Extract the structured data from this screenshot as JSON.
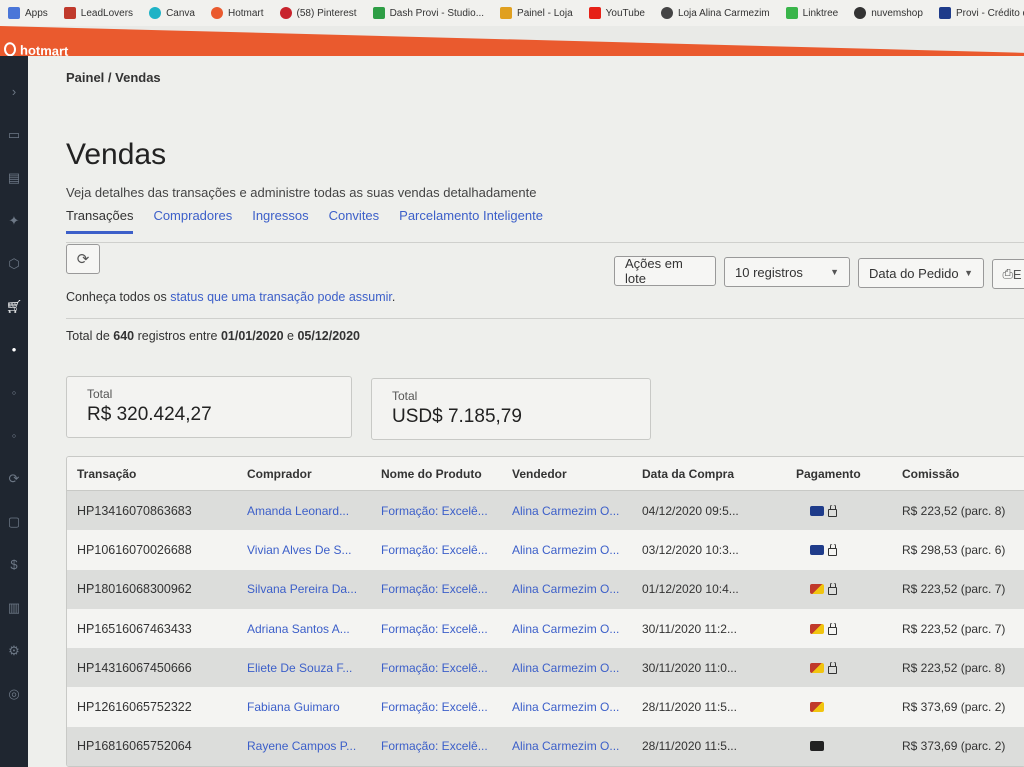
{
  "bookmarks": [
    {
      "label": "Apps",
      "color": "#4a76d8"
    },
    {
      "label": "LeadLovers",
      "color": "#c0392b"
    },
    {
      "label": "Canva",
      "color": "#1fb3c6"
    },
    {
      "label": "Hotmart",
      "color": "#ea5a2e"
    },
    {
      "label": "(58) Pinterest",
      "color": "#c8232c"
    },
    {
      "label": "Dash Provi - Studio...",
      "color": "#2e9e45"
    },
    {
      "label": "Painel - Loja",
      "color": "#e0a020"
    },
    {
      "label": "YouTube",
      "color": "#e62117"
    },
    {
      "label": "Loja Alina Carmezim",
      "color": "#444444"
    },
    {
      "label": "Linktree",
      "color": "#39b54a"
    },
    {
      "label": "nuvemshop",
      "color": "#333333"
    },
    {
      "label": "Provi - Crédito que...",
      "color": "#1e3b8a"
    }
  ],
  "header": {
    "logo_text": "hotmart",
    "color": "#ea5a2e"
  },
  "breadcrumb": "Painel  /  Vendas",
  "page": {
    "title": "Vendas",
    "subtitle": "Veja detalhes das transações e administre todas as suas vendas detalhadamente"
  },
  "tabs": [
    "Transações",
    "Compradores",
    "Ingressos",
    "Convites",
    "Parcelamento Inteligente"
  ],
  "toolbar": {
    "lote_label": "Ações em lote",
    "registros_label": "10 registros",
    "data_label": "Data do Pedido",
    "export_label": "E"
  },
  "status_text": {
    "prefix": "Conheça todos os ",
    "link": "status que uma transação pode assumir",
    "suffix": "."
  },
  "summary": {
    "prefix": "Total de ",
    "count": "640",
    "mid": " registros entre ",
    "start": "01/01/2020",
    "and": " e ",
    "end": "05/12/2020"
  },
  "cards": [
    {
      "label": "Total",
      "value": "R$ 320.424,27"
    },
    {
      "label": "Total",
      "value": "USD$ 7.185,79"
    }
  ],
  "table": {
    "columns": [
      "Transação",
      "Comprador",
      "Nome do Produto",
      "Vendedor",
      "Data da Compra",
      "Pagamento",
      "Comissão"
    ],
    "rows": [
      {
        "tx": "HP13416070863683",
        "buyer": "Amanda Leonard...",
        "product": "Formação: Excelê...",
        "seller": "Alina Carmezim O...",
        "date": "04/12/2020 09:5...",
        "pay_icon": "credit-card-icon",
        "lock": true,
        "commission": "R$ 223,52 (parc. 8)"
      },
      {
        "tx": "HP10616070026688",
        "buyer": "Vivian Alves De S...",
        "product": "Formação: Excelê...",
        "seller": "Alina Carmezim O...",
        "date": "03/12/2020 10:3...",
        "pay_icon": "credit-card-icon",
        "lock": true,
        "commission": "R$ 298,53 (parc. 6)"
      },
      {
        "tx": "HP18016068300962",
        "buyer": "Silvana Pereira Da...",
        "product": "Formação: Excelê...",
        "seller": "Alina Carmezim O...",
        "date": "01/12/2020 10:4...",
        "pay_icon": "mastercard-icon",
        "lock": true,
        "commission": "R$ 223,52 (parc. 7)"
      },
      {
        "tx": "HP16516067463433",
        "buyer": "Adriana Santos A...",
        "product": "Formação: Excelê...",
        "seller": "Alina Carmezim O...",
        "date": "30/11/2020 11:2...",
        "pay_icon": "mastercard-icon",
        "lock": true,
        "commission": "R$ 223,52 (parc. 7)"
      },
      {
        "tx": "HP14316067450666",
        "buyer": "Eliete De Souza F...",
        "product": "Formação: Excelê...",
        "seller": "Alina Carmezim O...",
        "date": "30/11/2020 11:0...",
        "pay_icon": "mastercard-icon",
        "lock": true,
        "commission": "R$ 223,52 (parc. 8)"
      },
      {
        "tx": "HP12616065752322",
        "buyer": "Fabiana Guimaro",
        "product": "Formação: Excelê...",
        "seller": "Alina Carmezim O...",
        "date": "28/11/2020 11:5...",
        "pay_icon": "mastercard-icon",
        "lock": false,
        "commission": "R$ 373,69 (parc. 2)"
      },
      {
        "tx": "HP16816065752064",
        "buyer": "Rayene Campos P...",
        "product": "Formação: Excelê...",
        "seller": "Alina Carmezim O...",
        "date": "28/11/2020 11:5...",
        "pay_icon": "dark-card-icon",
        "lock": false,
        "commission": "R$ 373,69 (parc. 2)"
      }
    ]
  }
}
